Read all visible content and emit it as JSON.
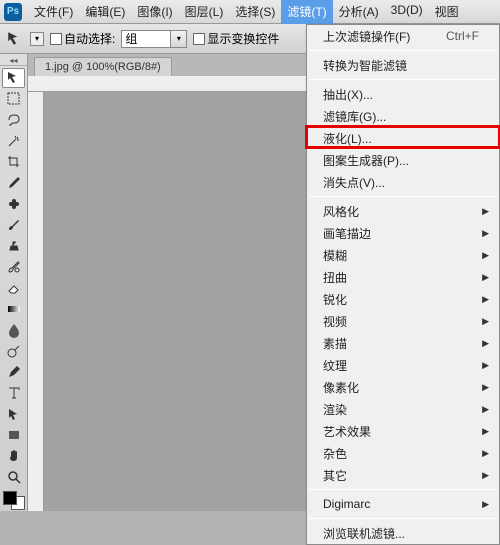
{
  "app": {
    "badge": "Ps"
  },
  "menubar": {
    "items": [
      "文件(F)",
      "编辑(E)",
      "图像(I)",
      "图层(L)",
      "选择(S)",
      "滤镜(T)",
      "分析(A)",
      "3D(D)",
      "视图"
    ],
    "open_index": 5
  },
  "options": {
    "auto_select_label": "自动选择:",
    "group_value": "组",
    "show_transform_label": "显示变换控件"
  },
  "document": {
    "tab_label": "1.jpg @ 100%(RGB/8#)"
  },
  "toolbox_icons": [
    "move",
    "marquee",
    "lasso",
    "magic-wand",
    "crop",
    "eyedropper",
    "spot-heal",
    "brush",
    "clone-stamp",
    "history-brush",
    "eraser",
    "gradient",
    "blur",
    "dodge",
    "pen",
    "type",
    "path-select",
    "rectangle",
    "hand",
    "zoom"
  ],
  "dropdown": {
    "last_filter": "上次滤镜操作(F)",
    "last_filter_shortcut": "Ctrl+F",
    "items_a": [
      "转换为智能滤镜"
    ],
    "items_b": [
      "抽出(X)...",
      "滤镜库(G)...",
      "液化(L)...",
      "图案生成器(P)...",
      "消失点(V)..."
    ],
    "highlight_index_b": 2,
    "items_c": [
      "风格化",
      "画笔描边",
      "模糊",
      "扭曲",
      "锐化",
      "视频",
      "素描",
      "纹理",
      "像素化",
      "渲染",
      "艺术效果",
      "杂色",
      "其它"
    ],
    "items_d": [
      "Digimarc"
    ],
    "items_e": [
      "浏览联机滤镜..."
    ]
  }
}
